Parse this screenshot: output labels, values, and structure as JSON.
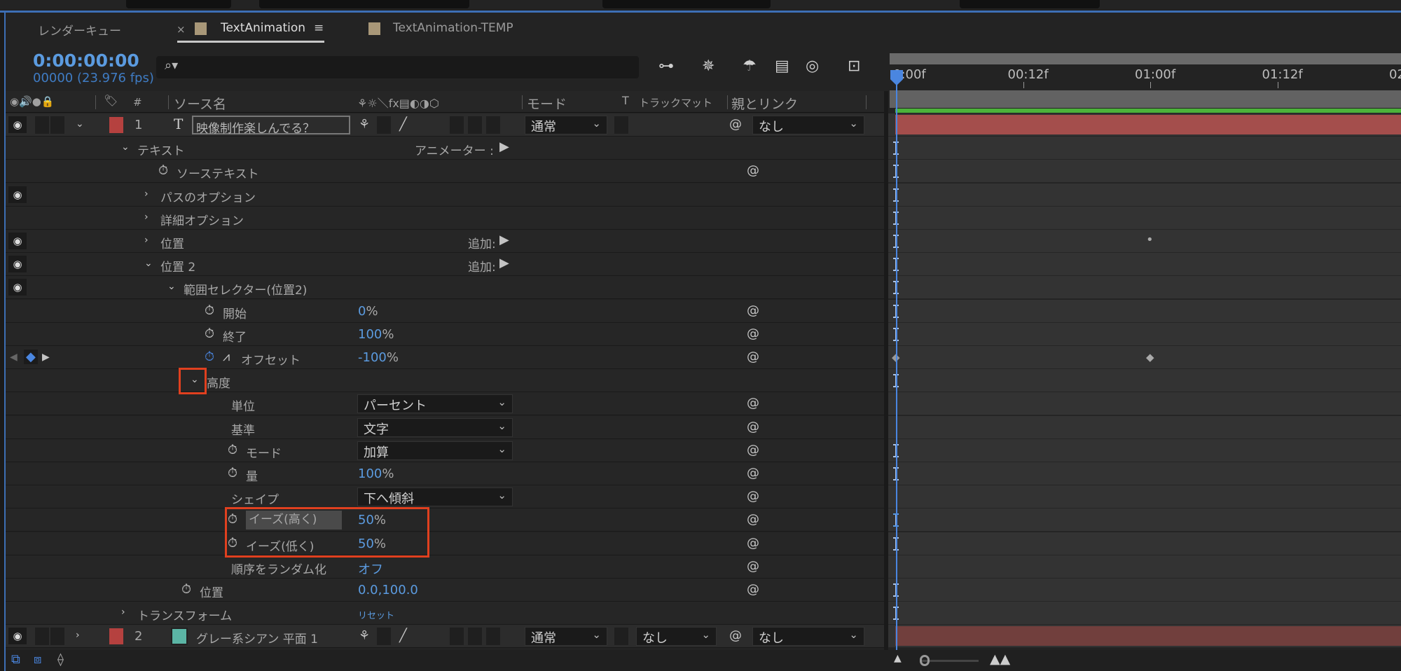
{
  "tabs": [
    {
      "label": "レンダーキュー"
    },
    {
      "label": "TextAnimation",
      "close": "×",
      "menu": "≡",
      "active": true
    },
    {
      "label": "TextAnimation-TEMP"
    }
  ],
  "time": {
    "timecode": "0:00:00:00",
    "frames": "00000 (23.976 fps)"
  },
  "search": {
    "icon": "search-icon",
    "glyph": "⌕▾",
    "value": ""
  },
  "toolbar_icons": [
    "composition-flowchart-icon",
    "draft-3d-icon",
    "shy-layers-icon",
    "frame-blending-icon",
    "motion-blur-icon",
    "graph-editor-icon"
  ],
  "header": {
    "av": "◉🔊●🔒",
    "label": "🏷",
    "num": "#",
    "source": "ソース名",
    "switches": "⚘☼＼fx▤◐◑⬡",
    "mode": "モード",
    "t": "T",
    "trackmatte": "トラックマット",
    "parent": "親とリンク"
  },
  "ruler": {
    "labels": [
      "0:00f",
      "00:12f",
      "01:00f",
      "01:12f",
      "02"
    ],
    "frames": [
      0,
      12,
      24,
      36,
      48
    ]
  },
  "colors": {
    "accent": "#5b9be0",
    "layer1": "#b5413f",
    "layer2_label": "#b5413f",
    "layer2_swatch": "#5bb5a5",
    "annotation": "#e0401f"
  },
  "layers": [
    {
      "num": "1",
      "type_icon": "T",
      "name": "映像制作楽しんでる？",
      "mode": "通常",
      "parent": "なし",
      "expanded": true
    },
    {
      "num": "2",
      "name": "グレー系シアン 平面 1",
      "mode": "通常",
      "trackmatte": "なし",
      "parent": "なし",
      "expanded": false
    }
  ],
  "rows": [
    {
      "label": "テキスト",
      "depth": 1,
      "exp": "open",
      "right": "アニメーター :",
      "marker": "ibeam"
    },
    {
      "label": "ソーステキスト",
      "depth": 2,
      "stopwatch": true,
      "spiral": true,
      "marker": "ibeam"
    },
    {
      "label": "パスのオプション",
      "depth": 2,
      "exp": "closed",
      "eye": true,
      "marker": "ibeam"
    },
    {
      "label": "詳細オプション",
      "depth": 2,
      "exp": "closed",
      "marker": "ibeam"
    },
    {
      "label": "位置",
      "depth": 2,
      "exp": "closed",
      "eye": true,
      "right": "追加:",
      "marker": "ibeam",
      "keyframes": [
        {
          "frame": 24,
          "shape": "dot"
        }
      ]
    },
    {
      "label": "位置 2",
      "depth": 2,
      "exp": "open",
      "eye": true,
      "right": "追加:",
      "marker": "ibeam"
    },
    {
      "label": "範囲セレクター(位置2)",
      "depth": 3,
      "exp": "open",
      "eye": true,
      "marker": "ibeam"
    },
    {
      "label": "開始",
      "depth": 4,
      "stopwatch": true,
      "value": "0",
      "unit": "%",
      "spiral": true,
      "marker": "ibeam"
    },
    {
      "label": "終了",
      "depth": 4,
      "stopwatch": true,
      "value": "100",
      "unit": "%",
      "spiral": true,
      "marker": "ibeam"
    },
    {
      "label": "オフセット",
      "depth": 4,
      "stopwatch": true,
      "active": true,
      "graph": true,
      "value": "-100",
      "unit": "%",
      "spiral": true,
      "kfnav": true,
      "marker": "diamond",
      "keyframes": [
        {
          "frame": 24,
          "shape": "diamond"
        }
      ]
    },
    {
      "label": "高度",
      "depth": 4,
      "exp": "open",
      "marker": "ibeam"
    },
    {
      "label": "単位",
      "depth": 5,
      "dropdown": "パーセント",
      "spiral": true
    },
    {
      "label": "基準",
      "depth": 5,
      "dropdown": "文字",
      "spiral": true
    },
    {
      "label": "モード",
      "depth": 5,
      "stopwatch": true,
      "dropdown": "加算",
      "spiral": true,
      "marker": "ibeam"
    },
    {
      "label": "量",
      "depth": 5,
      "stopwatch": true,
      "value": "100",
      "unit": "%",
      "spiral": true,
      "marker": "ibeam"
    },
    {
      "label": "シェイプ",
      "depth": 5,
      "dropdown": "下へ傾斜",
      "spiral": true
    },
    {
      "label": "イーズ(高く)",
      "depth": 5,
      "stopwatch": true,
      "highlight": true,
      "value": "50",
      "unit": "%",
      "spiral": true,
      "marker": "ibeam-blue"
    },
    {
      "label": "イーズ(低く)",
      "depth": 5,
      "stopwatch": true,
      "value": "50",
      "unit": "%",
      "spiral": true,
      "marker": "ibeam"
    },
    {
      "label": "順序をランダム化",
      "depth": 5,
      "value": "オフ",
      "spiral": true
    },
    {
      "label": "位置",
      "depth": 3,
      "stopwatch": true,
      "value": "0.0,100.0",
      "spiral": true,
      "marker": "ibeam"
    },
    {
      "label": "トランスフォーム",
      "depth": 1,
      "exp": "closed",
      "value": "リセット",
      "small": true,
      "marker": "ibeam"
    }
  ]
}
